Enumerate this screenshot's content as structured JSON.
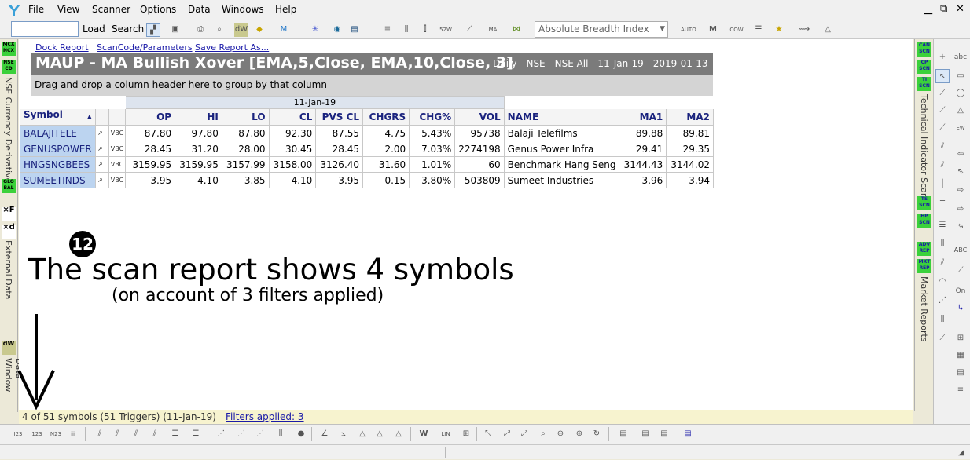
{
  "menu": [
    "File",
    "View",
    "Scanner",
    "Options",
    "Data",
    "Windows",
    "Help"
  ],
  "toolbar": {
    "search_value": "",
    "load_label": "Load",
    "search_label": "Search",
    "indicator_value": "Absolute Breadth Index (ABI"
  },
  "links": {
    "dock": "Dock Report",
    "scancode": "ScanCode/Parameters",
    "save": "Save Report As..."
  },
  "report": {
    "title": "MAUP - MA Bullish Xover [EMA,5,Close, EMA,10,Close, 3]",
    "subtitle": "- Daily - NSE - NSE All - 11-Jan-19 - 2019-01-13",
    "group_hint": "Drag and drop a column header here to group by that column",
    "date_header": "11-Jan-19",
    "columns": [
      "Symbol",
      "OP",
      "HI",
      "LO",
      "CL",
      "PVS CL",
      "CHGRS",
      "CHG%",
      "VOL",
      "NAME",
      "MA1",
      "MA2"
    ],
    "rows": [
      {
        "symbol": "BALAJITELE",
        "op": "87.80",
        "hi": "97.80",
        "lo": "87.80",
        "cl": "92.30",
        "pvs": "87.55",
        "chgrs": "4.75",
        "chgp": "5.43%",
        "vol": "95738",
        "name": "Balaji Telefilms",
        "ma1": "89.88",
        "ma2": "89.81"
      },
      {
        "symbol": "GENUSPOWER",
        "op": "28.45",
        "hi": "31.20",
        "lo": "28.00",
        "cl": "30.45",
        "pvs": "28.45",
        "chgrs": "2.00",
        "chgp": "7.03%",
        "vol": "2274198",
        "name": "Genus Power Infra",
        "ma1": "29.41",
        "ma2": "29.35"
      },
      {
        "symbol": "HNGSNGBEES",
        "op": "3159.95",
        "hi": "3159.95",
        "lo": "3157.99",
        "cl": "3158.00",
        "pvs": "3126.40",
        "chgrs": "31.60",
        "chgp": "1.01%",
        "vol": "60",
        "name": "Benchmark Hang Seng",
        "ma1": "3144.43",
        "ma2": "3144.02"
      },
      {
        "symbol": "SUMEETINDS",
        "op": "3.95",
        "hi": "4.10",
        "lo": "3.85",
        "cl": "4.10",
        "pvs": "3.95",
        "chgrs": "0.15",
        "chgp": "3.80%",
        "vol": "503809",
        "name": "Sumeet Industries",
        "ma1": "3.96",
        "ma2": "3.94"
      }
    ]
  },
  "annotation": {
    "badge": "12",
    "line1": "The scan report shows 4 symbols",
    "line2": "(on account of 3 filters applied)"
  },
  "status": {
    "text": "4 of 51 symbols (51 Triggers) (11-Jan-19)",
    "filters": "Filters applied: 3"
  },
  "left_rail": {
    "currency": "NSE Currency Derivatives",
    "external": "External Data",
    "datawin": "Data Window"
  },
  "right_rail": {
    "tech": "Technical Indicator Scans",
    "market": "Market Reports"
  }
}
